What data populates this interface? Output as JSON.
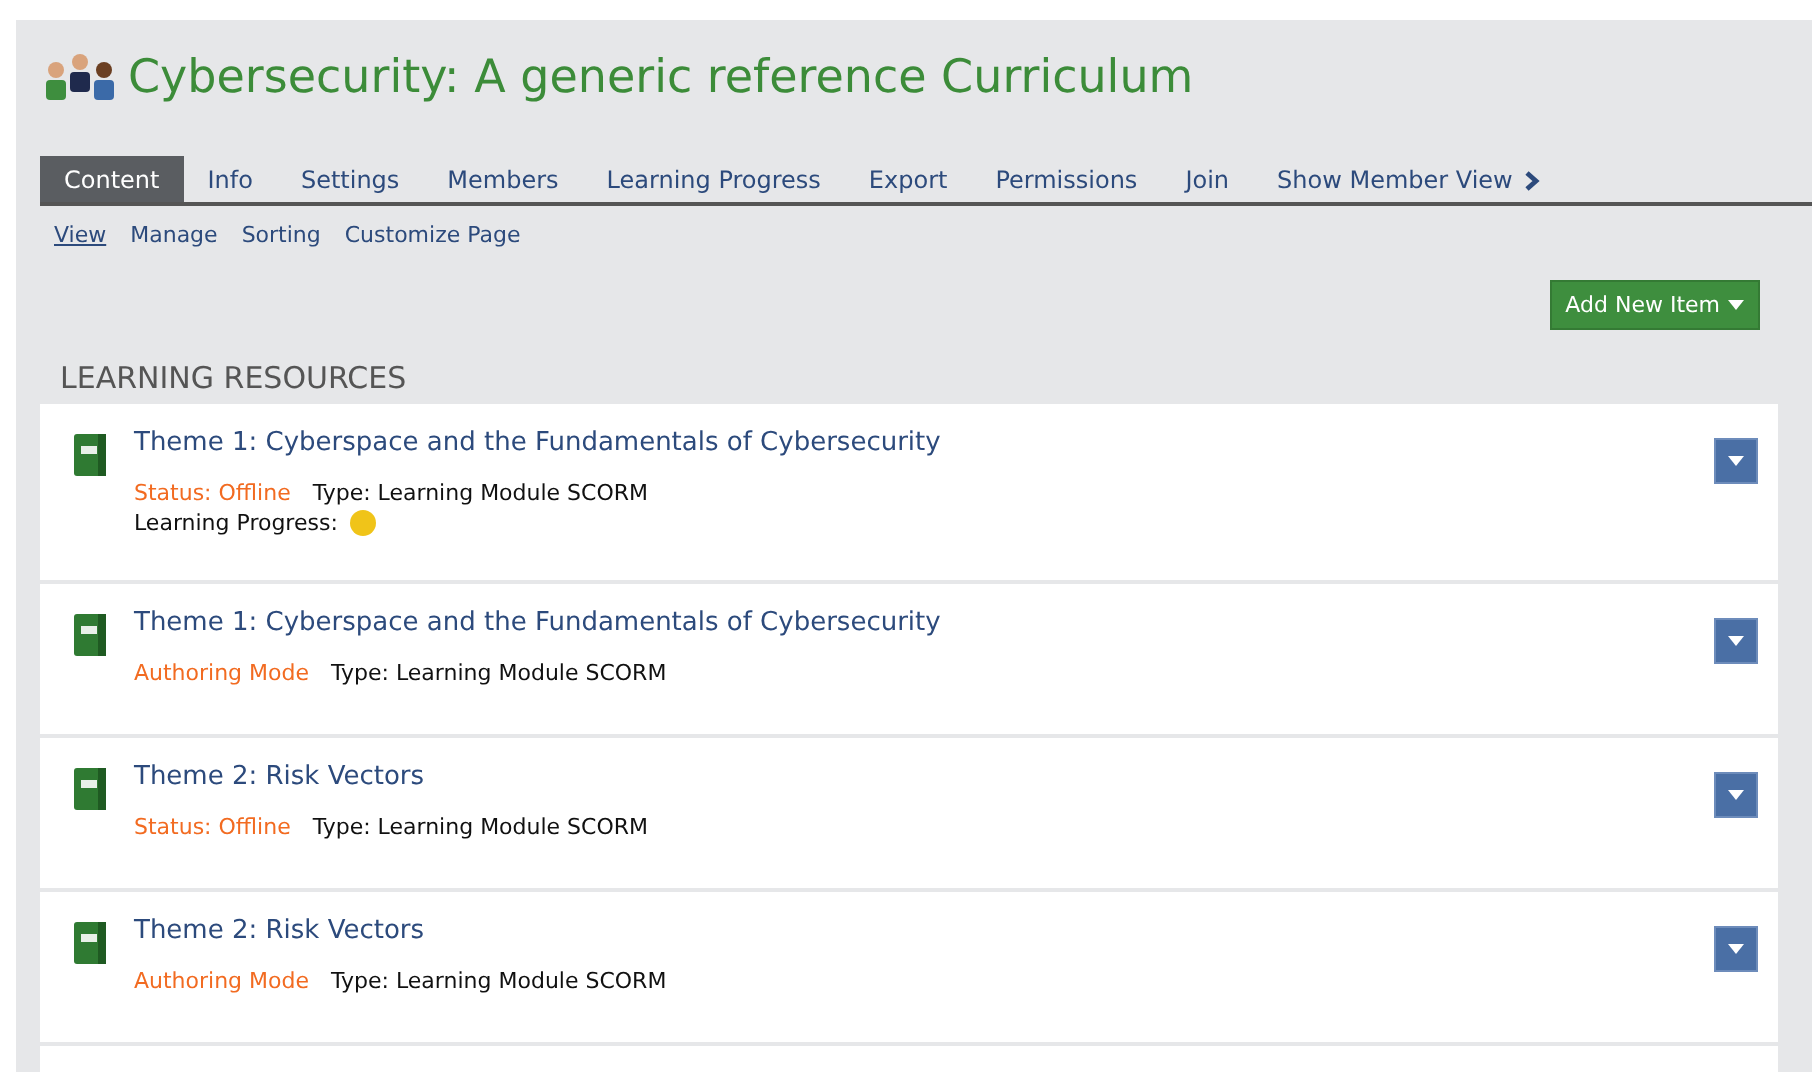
{
  "title": "Cybersecurity: A generic reference Curriculum",
  "tabs": [
    {
      "label": "Content",
      "selected": true
    },
    {
      "label": "Info",
      "selected": false
    },
    {
      "label": "Settings",
      "selected": false
    },
    {
      "label": "Members",
      "selected": false
    },
    {
      "label": "Learning Progress",
      "selected": false
    },
    {
      "label": "Export",
      "selected": false
    },
    {
      "label": "Permissions",
      "selected": false
    },
    {
      "label": "Join",
      "selected": false
    },
    {
      "label": "Show Member View",
      "selected": false
    }
  ],
  "subtabs": [
    {
      "label": "View",
      "selected": true
    },
    {
      "label": "Manage",
      "selected": false
    },
    {
      "label": "Sorting",
      "selected": false
    },
    {
      "label": "Customize Page",
      "selected": false
    }
  ],
  "add_button": "Add New Item",
  "section_title": "LEARNING RESOURCES",
  "items": [
    {
      "title": "Theme 1: Cyberspace and the Fundamentals of Cybersecurity",
      "status": "Status: Offline",
      "type": "Type: Learning Module SCORM",
      "progress": {
        "label": "Learning Progress:",
        "color": "#f0c419"
      }
    },
    {
      "title": "Theme 1: Cyberspace and the Fundamentals of Cybersecurity",
      "status": "Authoring Mode",
      "type": "Type: Learning Module SCORM"
    },
    {
      "title": "Theme 2: Risk Vectors",
      "status": "Status: Offline",
      "type": "Type: Learning Module SCORM"
    },
    {
      "title": "Theme 2: Risk Vectors",
      "status": "Authoring Mode",
      "type": "Type: Learning Module SCORM"
    }
  ]
}
